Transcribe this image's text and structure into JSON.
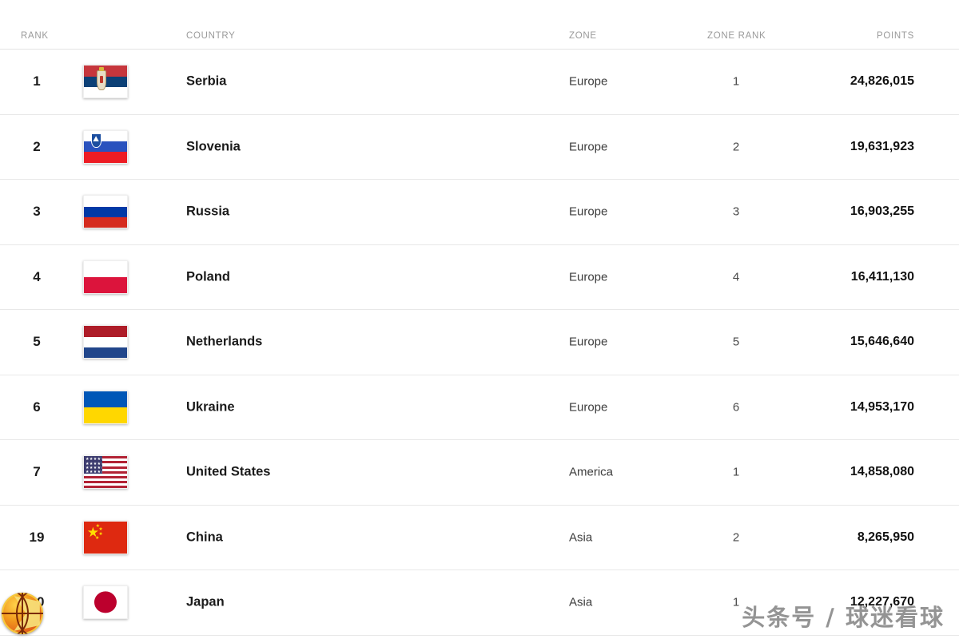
{
  "table": {
    "columns": {
      "rank": "RANK",
      "country": "COUNTRY",
      "zone": "ZONE",
      "zone_rank": "ZONE RANK",
      "points": "POINTS"
    },
    "rows": [
      {
        "rank": "1",
        "flag": "serbia-flag",
        "country": "Serbia",
        "zone": "Europe",
        "zone_rank": "1",
        "points": "24,826,015"
      },
      {
        "rank": "2",
        "flag": "slovenia-flag",
        "country": "Slovenia",
        "zone": "Europe",
        "zone_rank": "2",
        "points": "19,631,923"
      },
      {
        "rank": "3",
        "flag": "russia-flag",
        "country": "Russia",
        "zone": "Europe",
        "zone_rank": "3",
        "points": "16,903,255"
      },
      {
        "rank": "4",
        "flag": "poland-flag",
        "country": "Poland",
        "zone": "Europe",
        "zone_rank": "4",
        "points": "16,411,130"
      },
      {
        "rank": "5",
        "flag": "netherlands-flag",
        "country": "Netherlands",
        "zone": "Europe",
        "zone_rank": "5",
        "points": "15,646,640"
      },
      {
        "rank": "6",
        "flag": "ukraine-flag",
        "country": "Ukraine",
        "zone": "Europe",
        "zone_rank": "6",
        "points": "14,953,170"
      },
      {
        "rank": "7",
        "flag": "united-states-flag",
        "country": "United States",
        "zone": "America",
        "zone_rank": "1",
        "points": "14,858,080"
      },
      {
        "rank": "19",
        "flag": "china-flag",
        "country": "China",
        "zone": "Asia",
        "zone_rank": "2",
        "points": "8,265,950"
      },
      {
        "rank": "10",
        "flag": "japan-flag",
        "country": "Japan",
        "zone": "Asia",
        "zone_rank": "1",
        "points": "12,227,670"
      }
    ]
  },
  "overlays": {
    "watermark": "头条号 / 球迷看球",
    "logo": "basketball-logo"
  },
  "colors": {
    "text": "#1b1b1b",
    "muted": "#9a9a9a",
    "divider": "#e8e8e8"
  }
}
